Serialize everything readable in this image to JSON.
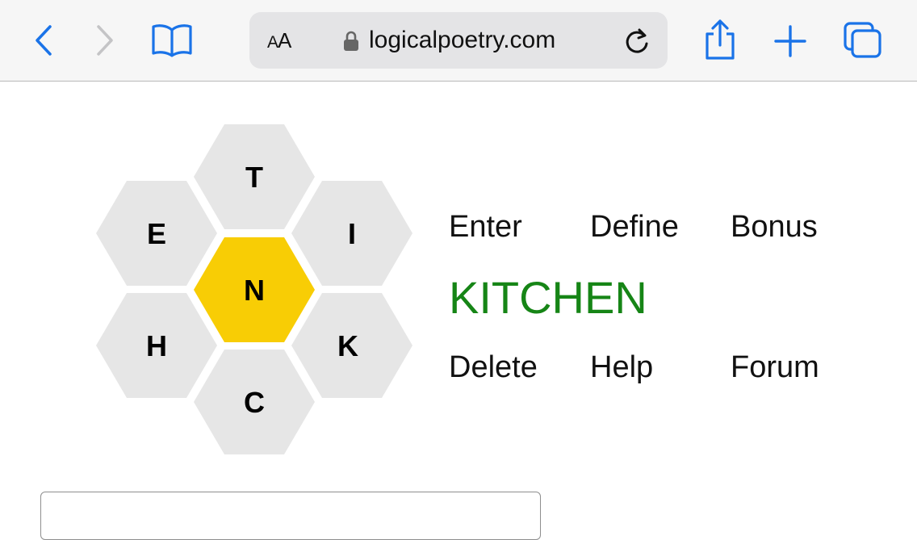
{
  "browser": {
    "url": "logicalpoetry.com",
    "text_size_large": "A",
    "text_size_small": "A",
    "icons": [
      "back-icon",
      "forward-icon",
      "bookmarks-icon",
      "lock-icon",
      "reload-icon",
      "share-icon",
      "new-tab-icon",
      "tabs-icon"
    ],
    "accent_color": "#1a73e8"
  },
  "puzzle": {
    "center_letter": "N",
    "outer_letters": [
      "T",
      "I",
      "K",
      "C",
      "H",
      "E"
    ],
    "center_color": "#f8cd05",
    "outer_color": "#e6e6e6"
  },
  "actions": {
    "enter": "Enter",
    "define": "Define",
    "bonus": "Bonus",
    "delete": "Delete",
    "help": "Help",
    "forum": "Forum"
  },
  "current_word": {
    "text": "KITCHEN",
    "color": "#168516"
  },
  "input": {
    "value": ""
  }
}
